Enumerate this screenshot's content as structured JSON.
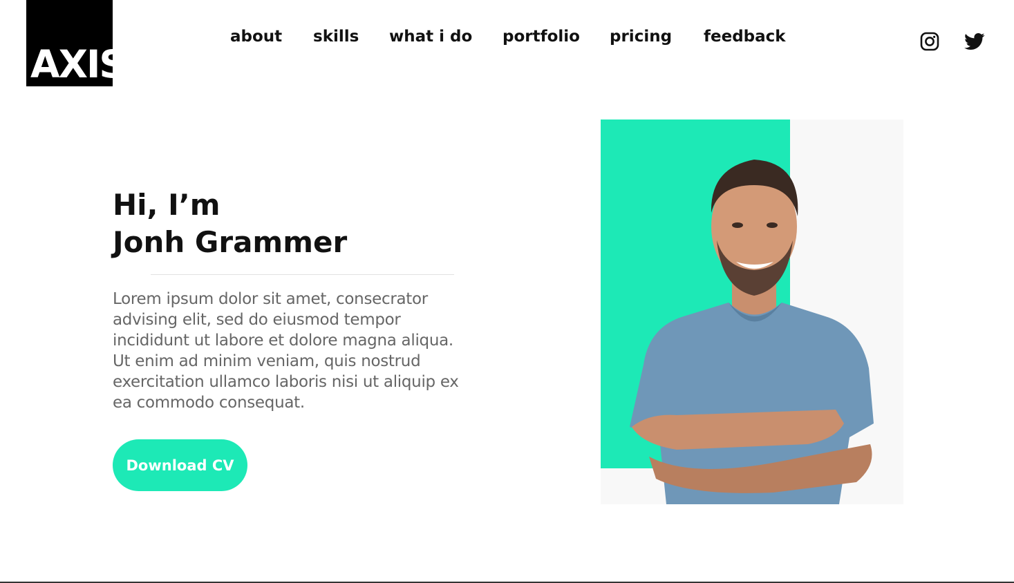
{
  "logo": {
    "text": "AXIS"
  },
  "nav": {
    "items": [
      {
        "label": "about"
      },
      {
        "label": "skills"
      },
      {
        "label": "what i do"
      },
      {
        "label": "portfolio"
      },
      {
        "label": "pricing"
      },
      {
        "label": "feedback"
      }
    ]
  },
  "social": {
    "instagram_icon": "instagram-icon",
    "twitter_icon": "twitter-icon"
  },
  "hero": {
    "greeting_line1": "Hi, I’m",
    "greeting_line2": "Jonh Grammer",
    "bio": "Lorem ipsum dolor sit amet, consecrator advising elit, sed do eiusmod tempor incididunt ut labore et dolore magna aliqua. Ut enim ad minim veniam, quis nostrud exercitation ullamco laboris nisi ut aliquip ex ea commodo consequat.",
    "cta_label": "Download CV"
  },
  "colors": {
    "accent": "#1de9b6",
    "text": "#111111",
    "muted_text": "#666666",
    "logo_bg": "#000000",
    "shirt": "#6f97b8"
  }
}
